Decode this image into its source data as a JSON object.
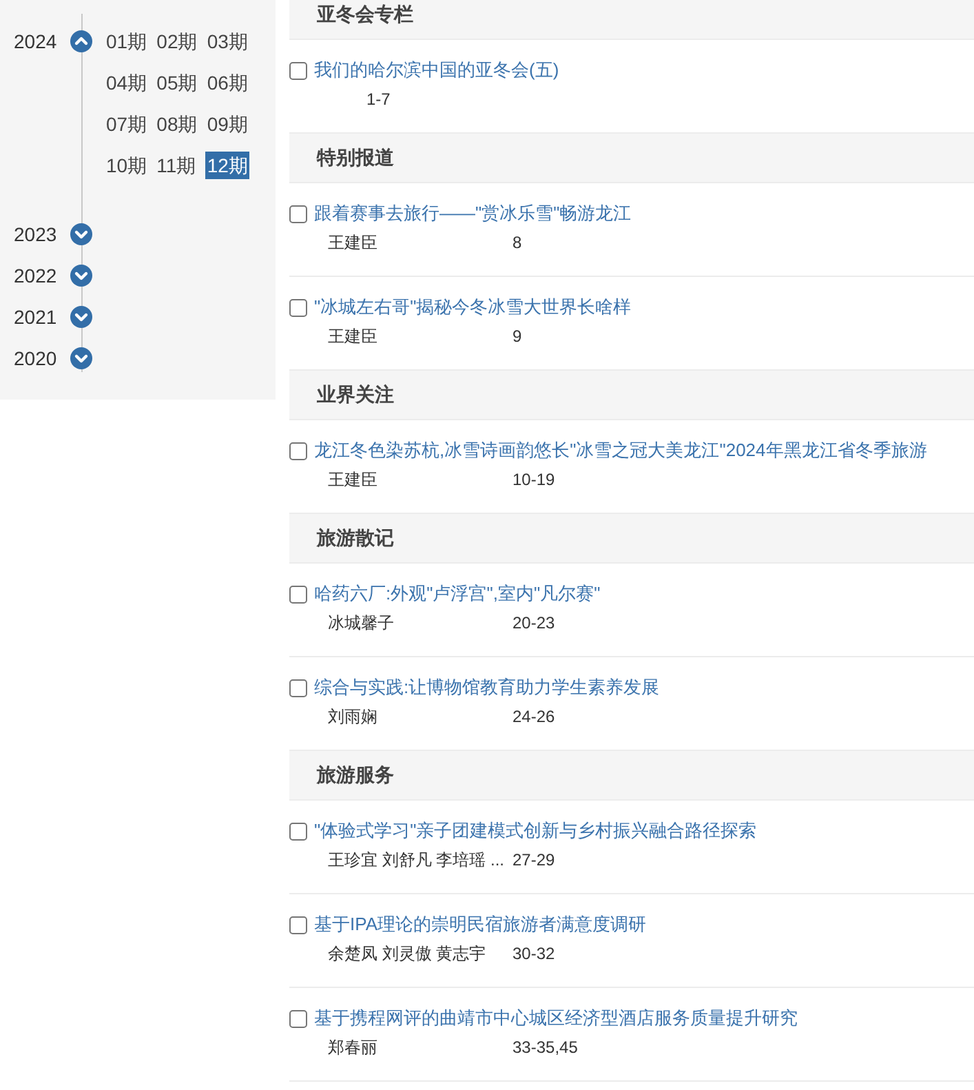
{
  "sidebar": {
    "years": [
      {
        "year": "2024",
        "expanded": true,
        "issues": [
          {
            "label": "01期",
            "selected": false
          },
          {
            "label": "02期",
            "selected": false
          },
          {
            "label": "03期",
            "selected": false
          },
          {
            "label": "04期",
            "selected": false
          },
          {
            "label": "05期",
            "selected": false
          },
          {
            "label": "06期",
            "selected": false
          },
          {
            "label": "07期",
            "selected": false
          },
          {
            "label": "08期",
            "selected": false
          },
          {
            "label": "09期",
            "selected": false
          },
          {
            "label": "10期",
            "selected": false
          },
          {
            "label": "11期",
            "selected": false
          },
          {
            "label": "12期",
            "selected": true
          }
        ]
      },
      {
        "year": "2023",
        "expanded": false
      },
      {
        "year": "2022",
        "expanded": false
      },
      {
        "year": "2021",
        "expanded": false
      },
      {
        "year": "2020",
        "expanded": false
      }
    ]
  },
  "sections": [
    {
      "title": "亚冬会专栏",
      "articles": [
        {
          "title": "我们的哈尔滨中国的亚冬会(五)",
          "pages": "1-7",
          "checked": false
        }
      ]
    },
    {
      "title": "特别报道",
      "articles": [
        {
          "title": "跟着赛事去旅行——\"赏冰乐雪\"畅游龙江",
          "author": "王建臣",
          "pages": "8",
          "checked": false
        },
        {
          "title": "\"冰城左右哥\"揭秘今冬冰雪大世界长啥样",
          "author": "王建臣",
          "pages": "9",
          "checked": false
        }
      ]
    },
    {
      "title": "业界关注",
      "articles": [
        {
          "title": "龙江冬色染苏杭,冰雪诗画韵悠长\"冰雪之冠大美龙江\"2024年黑龙江省冬季旅游",
          "author": "王建臣",
          "pages": "10-19",
          "checked": false
        }
      ]
    },
    {
      "title": "旅游散记",
      "articles": [
        {
          "title": "哈药六厂:外观\"卢浮宫\",室内\"凡尔赛\"",
          "author": "冰城馨子",
          "pages": "20-23",
          "checked": false
        },
        {
          "title": "综合与实践:让博物馆教育助力学生素养发展",
          "author": "刘雨娴",
          "pages": "24-26",
          "checked": false
        }
      ]
    },
    {
      "title": "旅游服务",
      "articles": [
        {
          "title": "\"体验式学习\"亲子团建模式创新与乡村振兴融合路径探索",
          "author": "王珍宜 刘舒凡 李培瑶 ...",
          "pages": "27-29",
          "checked": false
        },
        {
          "title": "基于IPA理论的崇明民宿旅游者满意度调研",
          "author": "余楚凤 刘灵傲 黄志宇",
          "pages": "30-32",
          "checked": false
        },
        {
          "title": "基于携程网评的曲靖市中心城区经济型酒店服务质量提升研究",
          "author": "郑春丽",
          "pages": "33-35,45",
          "checked": false
        }
      ]
    }
  ]
}
